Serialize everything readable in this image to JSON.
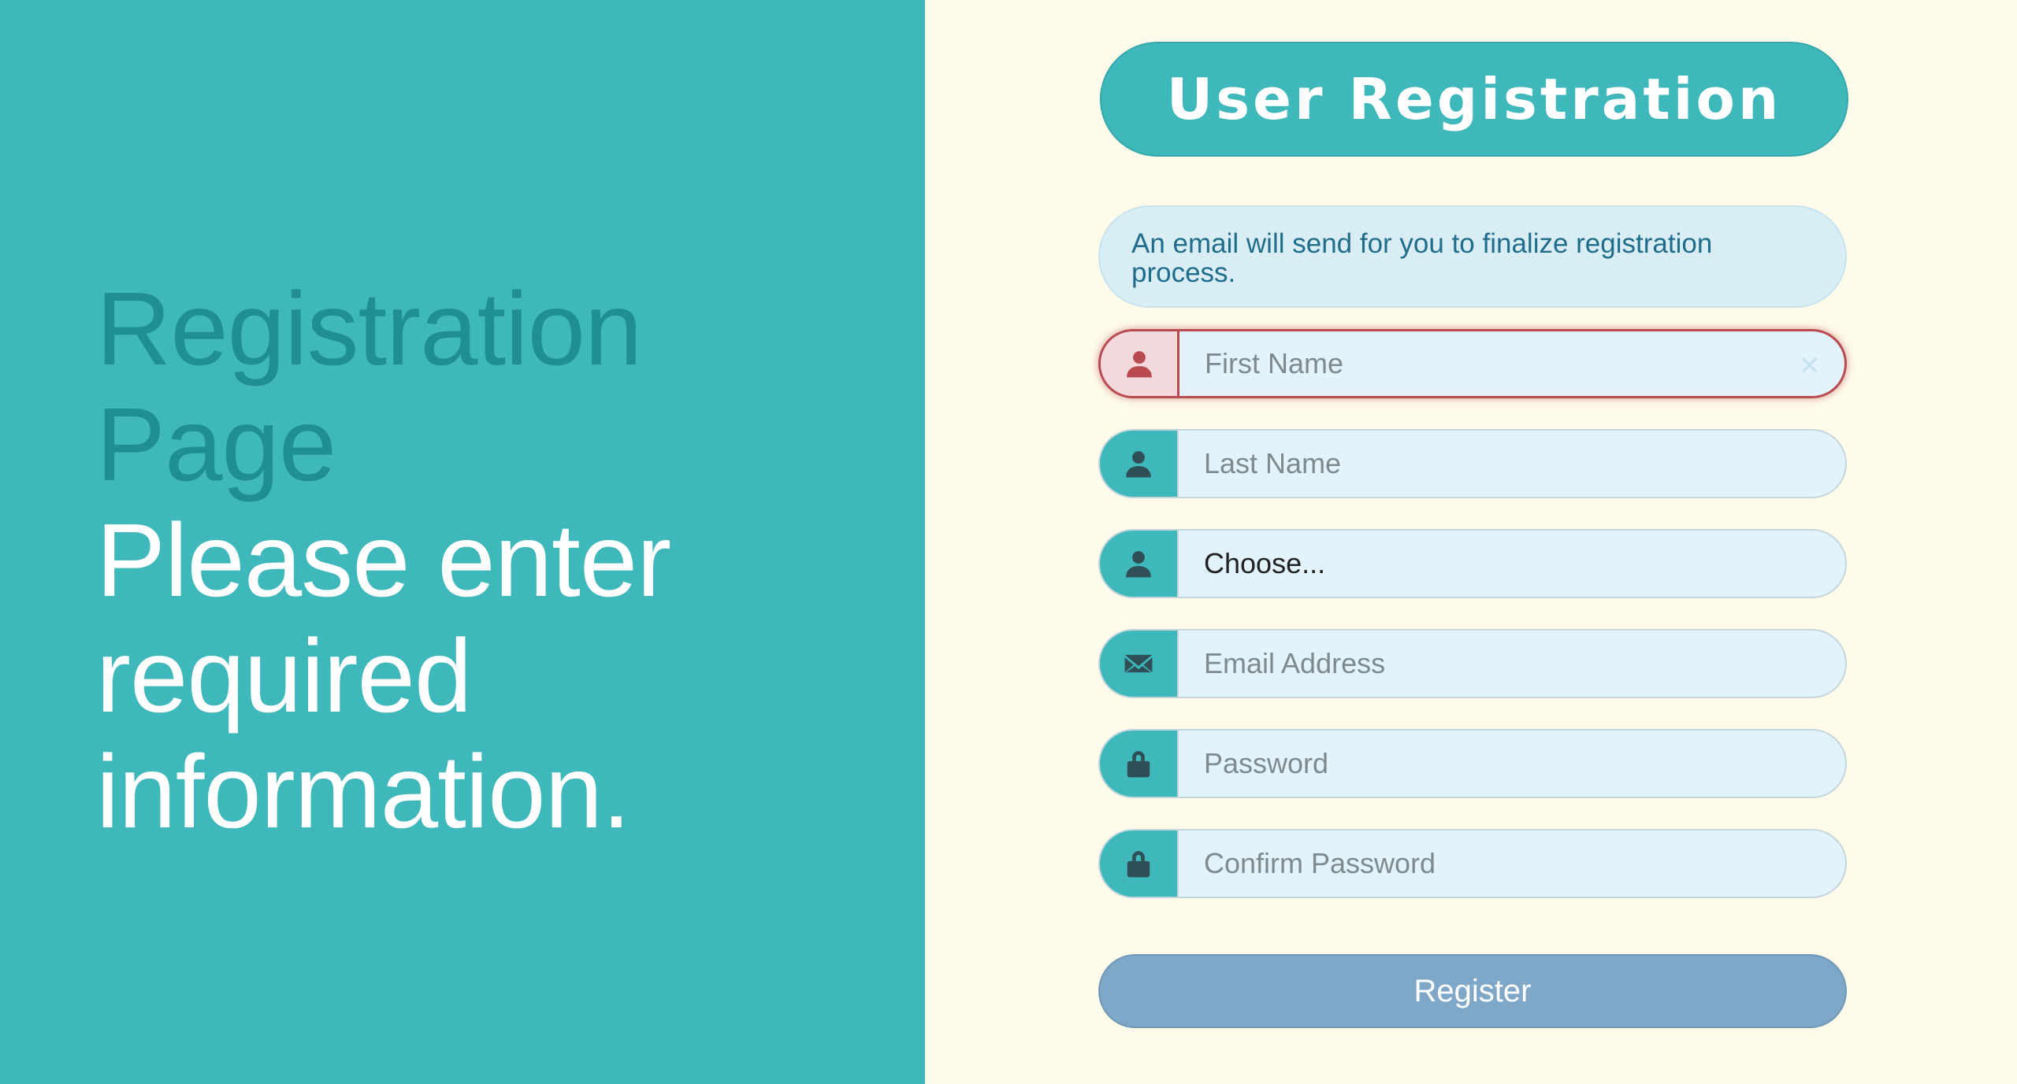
{
  "hero": {
    "line1": "Registration",
    "line2": "Page",
    "line3": "Please enter",
    "line4": "required",
    "line5": "information."
  },
  "form": {
    "title": "User Registration",
    "info": "An email will send for you to finalize registration process.",
    "first_name": {
      "placeholder": "First Name",
      "icon": "user-icon"
    },
    "last_name": {
      "placeholder": "Last Name",
      "icon": "user-icon"
    },
    "select": {
      "value": "Choose...",
      "icon": "user-icon"
    },
    "email": {
      "placeholder": "Email Address",
      "icon": "envelope-icon"
    },
    "password": {
      "placeholder": "Password",
      "icon": "lock-icon"
    },
    "confirm_password": {
      "placeholder": "Confirm Password",
      "icon": "lock-icon"
    },
    "clear_glyph": "✕",
    "register_label": "Register"
  },
  "colors": {
    "teal": "#3fb8bc",
    "dark_teal": "#1f8f93",
    "cream": "#fefbea",
    "error": "#b84a50",
    "button": "#7fa8c8"
  }
}
